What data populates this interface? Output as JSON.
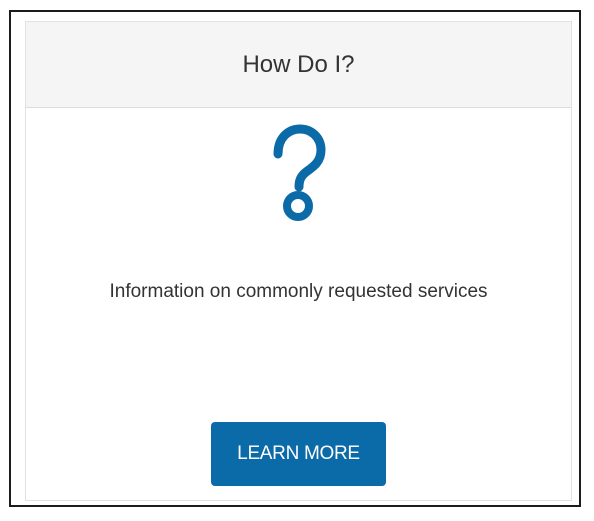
{
  "card": {
    "title": "How Do I?",
    "icon": "question-mark-icon",
    "description": "Information on commonly requested services",
    "button_label": "LEARN MORE"
  },
  "colors": {
    "accent": "#0b6aa8",
    "header_bg": "#f5f5f5",
    "text": "#333333"
  }
}
